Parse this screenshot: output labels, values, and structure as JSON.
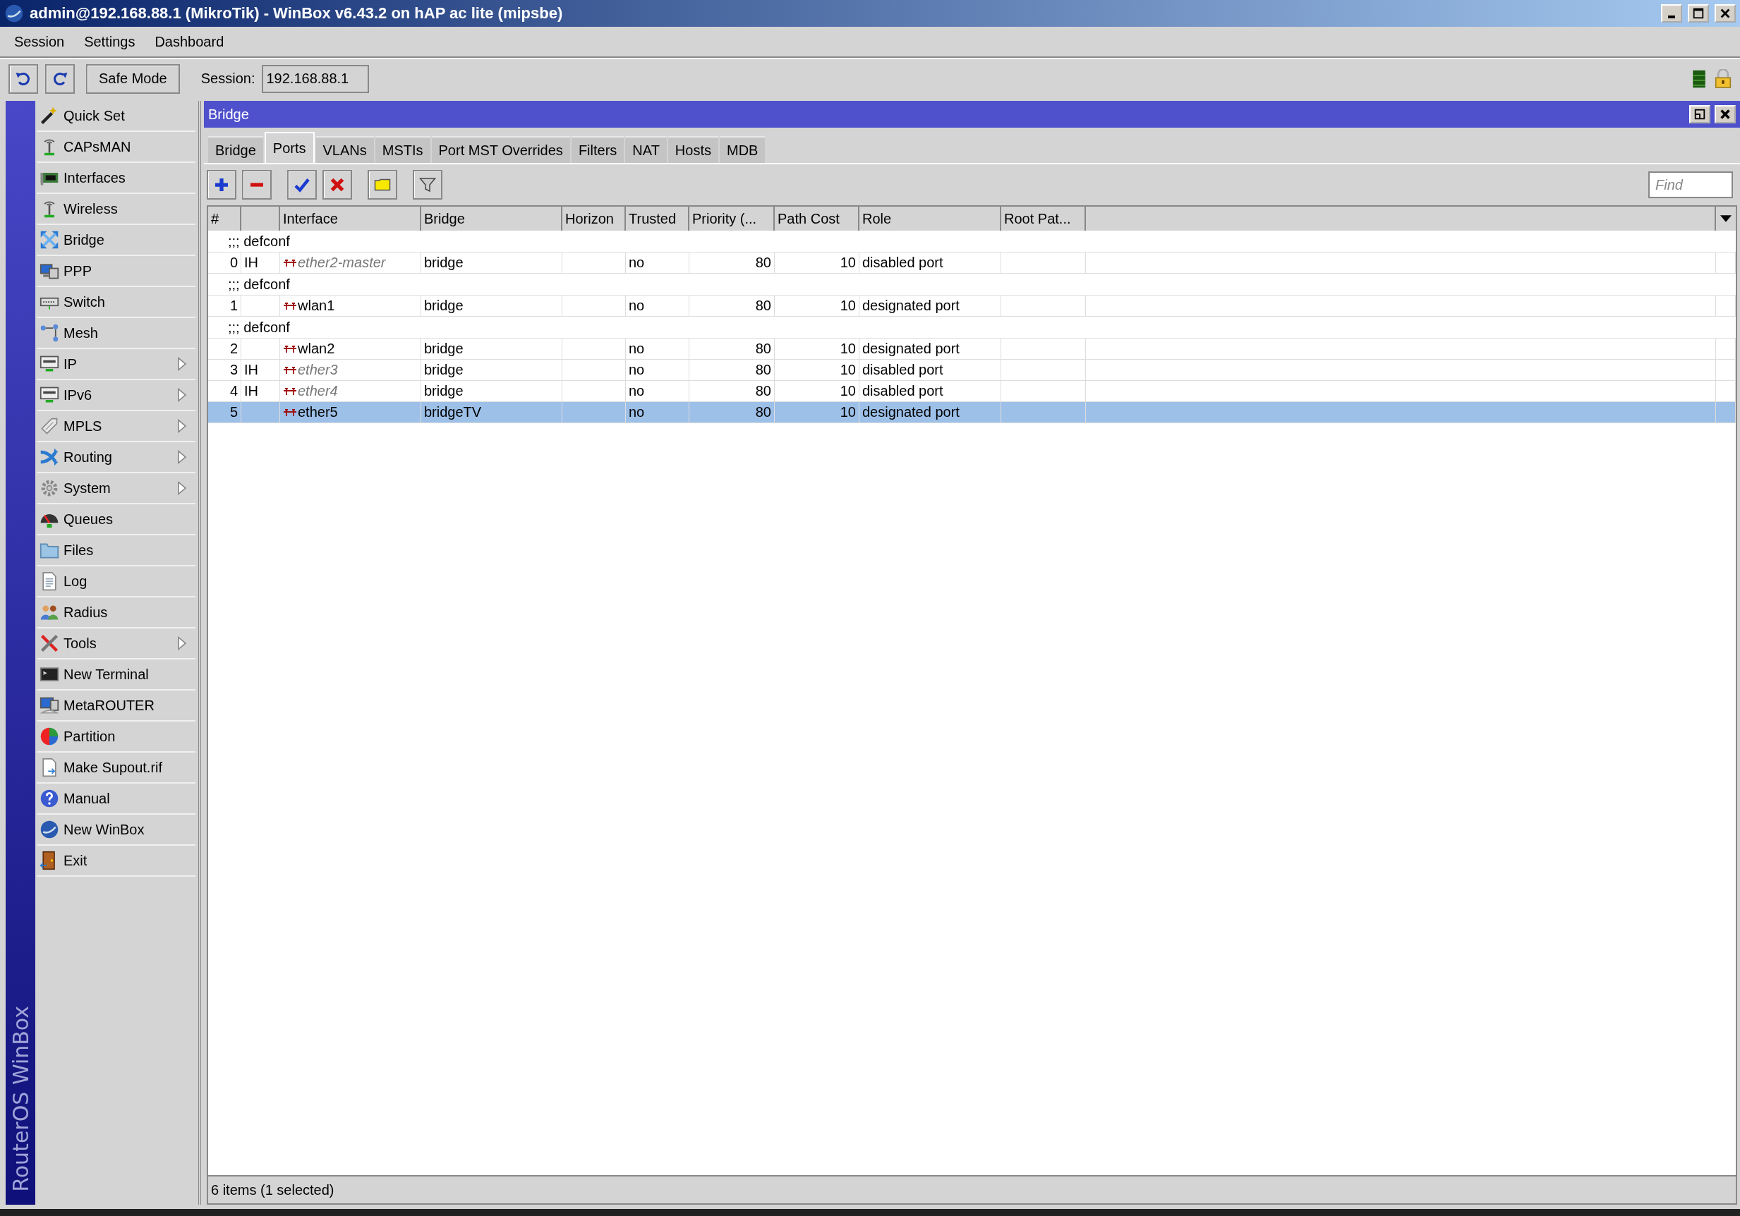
{
  "window": {
    "title": "admin@192.168.88.1 (MikroTik) - WinBox v6.43.2 on hAP ac lite (mipsbe)"
  },
  "menu": [
    "Session",
    "Settings",
    "Dashboard"
  ],
  "toolbar": {
    "safe_mode": "Safe Mode",
    "session_label": "Session:",
    "session_value": "192.168.88.1"
  },
  "sidebar": {
    "brand": "RouterOS WinBox",
    "items": [
      {
        "label": "Quick Set",
        "submenu": false
      },
      {
        "label": "CAPsMAN",
        "submenu": false
      },
      {
        "label": "Interfaces",
        "submenu": false
      },
      {
        "label": "Wireless",
        "submenu": false
      },
      {
        "label": "Bridge",
        "submenu": false
      },
      {
        "label": "PPP",
        "submenu": false
      },
      {
        "label": "Switch",
        "submenu": false
      },
      {
        "label": "Mesh",
        "submenu": false
      },
      {
        "label": "IP",
        "submenu": true
      },
      {
        "label": "IPv6",
        "submenu": true
      },
      {
        "label": "MPLS",
        "submenu": true
      },
      {
        "label": "Routing",
        "submenu": true
      },
      {
        "label": "System",
        "submenu": true
      },
      {
        "label": "Queues",
        "submenu": false
      },
      {
        "label": "Files",
        "submenu": false
      },
      {
        "label": "Log",
        "submenu": false
      },
      {
        "label": "Radius",
        "submenu": false
      },
      {
        "label": "Tools",
        "submenu": true
      },
      {
        "label": "New Terminal",
        "submenu": false
      },
      {
        "label": "MetaROUTER",
        "submenu": false
      },
      {
        "label": "Partition",
        "submenu": false
      },
      {
        "label": "Make Supout.rif",
        "submenu": false
      },
      {
        "label": "Manual",
        "submenu": false
      },
      {
        "label": "New WinBox",
        "submenu": false
      },
      {
        "label": "Exit",
        "submenu": false
      }
    ]
  },
  "bridge_window": {
    "title": "Bridge",
    "tabs": [
      {
        "label": "Bridge",
        "selected": false
      },
      {
        "label": "Ports",
        "selected": true
      },
      {
        "label": "VLANs",
        "selected": false
      },
      {
        "label": "MSTIs",
        "selected": false
      },
      {
        "label": "Port MST Overrides",
        "selected": false
      },
      {
        "label": "Filters",
        "selected": false
      },
      {
        "label": "NAT",
        "selected": false
      },
      {
        "label": "Hosts",
        "selected": false
      },
      {
        "label": "MDB",
        "selected": false
      }
    ],
    "find": {
      "placeholder": "Find"
    },
    "table": {
      "columns": [
        "#",
        "Interface",
        "Bridge",
        "Horizon",
        "Trusted",
        "Priority (...",
        "Path Cost",
        "Role",
        "Root Pat..."
      ],
      "rows": [
        {
          "kind": "comment",
          "text": ";;; defconf"
        },
        {
          "kind": "port",
          "number": "0",
          "flags": "IH",
          "interface": "ether2-master",
          "bridge": "bridge",
          "trusted": "no",
          "priority": "80",
          "path_cost": "10",
          "role": "disabled port",
          "disabled": true,
          "selected": false
        },
        {
          "kind": "comment",
          "text": ";;; defconf"
        },
        {
          "kind": "port",
          "number": "1",
          "interface": "wlan1",
          "bridge": "bridge",
          "trusted": "no",
          "priority": "80",
          "path_cost": "10",
          "role": "designated port",
          "disabled": false,
          "selected": false
        },
        {
          "kind": "comment",
          "text": ";;; defconf"
        },
        {
          "kind": "port",
          "number": "2",
          "interface": "wlan2",
          "bridge": "bridge",
          "trusted": "no",
          "priority": "80",
          "path_cost": "10",
          "role": "designated port",
          "disabled": false,
          "selected": false
        },
        {
          "kind": "port",
          "number": "3",
          "flags": "IH",
          "interface": "ether3",
          "bridge": "bridge",
          "trusted": "no",
          "priority": "80",
          "path_cost": "10",
          "role": "disabled port",
          "disabled": true,
          "selected": false
        },
        {
          "kind": "port",
          "number": "4",
          "flags": "IH",
          "interface": "ether4",
          "bridge": "bridge",
          "trusted": "no",
          "priority": "80",
          "path_cost": "10",
          "role": "disabled port",
          "disabled": true,
          "selected": false
        },
        {
          "kind": "port",
          "number": "5",
          "interface": "ether5",
          "bridge": "bridgeTV",
          "trusted": "no",
          "priority": "80",
          "path_cost": "10",
          "role": "designated port",
          "disabled": false,
          "selected": true
        }
      ]
    },
    "status_bar": "6 items (1 selected)"
  }
}
